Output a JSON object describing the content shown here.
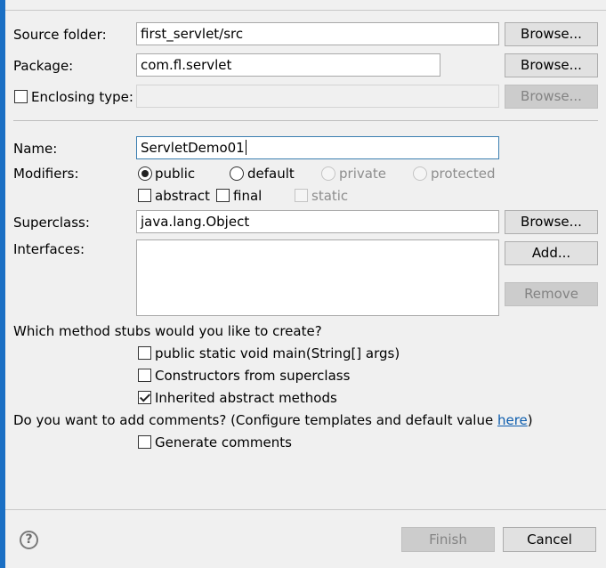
{
  "source_folder": {
    "label": "Source folder:",
    "value": "first_servlet/src",
    "browse": "Browse..."
  },
  "package": {
    "label": "Package:",
    "value": "com.fl.servlet",
    "browse": "Browse..."
  },
  "enclosing_type": {
    "label": "Enclosing type:",
    "value": "",
    "browse": "Browse...",
    "checked": false
  },
  "name": {
    "label": "Name:",
    "value": "ServletDemo01"
  },
  "modifiers": {
    "label": "Modifiers:",
    "public": "public",
    "default": "default",
    "private": "private",
    "protected": "protected",
    "abstract": "abstract",
    "final": "final",
    "static": "static",
    "selected": "public"
  },
  "superclass": {
    "label": "Superclass:",
    "value": "java.lang.Object",
    "browse": "Browse..."
  },
  "interfaces": {
    "label": "Interfaces:",
    "add": "Add...",
    "remove": "Remove"
  },
  "stubs": {
    "question": "Which method stubs would you like to create?",
    "main": "public static void main(String[] args)",
    "constructors": "Constructors from superclass",
    "inherited": "Inherited abstract methods",
    "main_checked": false,
    "constructors_checked": false,
    "inherited_checked": true
  },
  "comments": {
    "question": "Do you want to add comments? (Configure templates and default value ",
    "link": "here",
    "suffix": ")",
    "generate": "Generate comments",
    "generate_checked": false
  },
  "footer": {
    "help_glyph": "?",
    "finish": "Finish",
    "cancel": "Cancel"
  },
  "colors": {
    "accent": "#1a6fc4",
    "link": "#0b5cad",
    "focus_border": "#3c7fb1"
  }
}
